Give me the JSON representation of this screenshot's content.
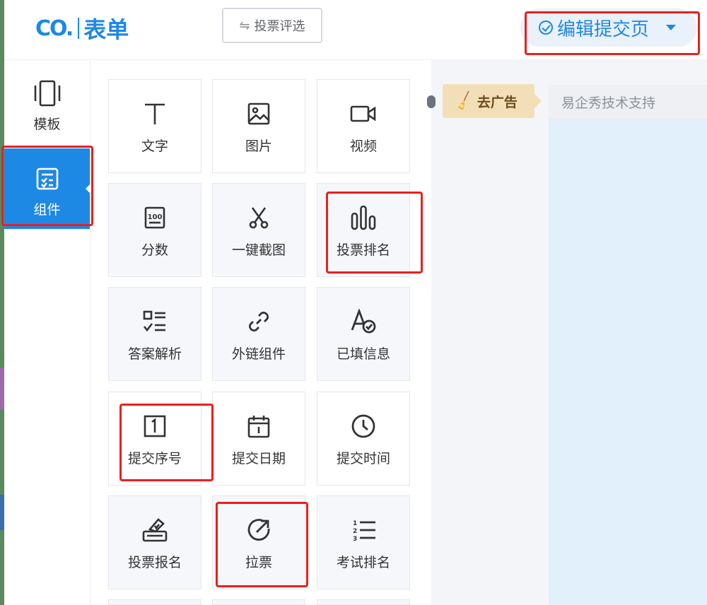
{
  "header": {
    "logo_mark": "CO.",
    "logo_text": "表单",
    "filter_button": "投票评选",
    "edit_menu": "编辑提交页"
  },
  "sidebar": {
    "items": [
      {
        "label": "模板",
        "icon": "template-icon",
        "active": false
      },
      {
        "label": "组件",
        "icon": "components-icon",
        "active": true
      }
    ]
  },
  "components": [
    {
      "label": "文字",
      "icon": "text-icon"
    },
    {
      "label": "图片",
      "icon": "image-icon"
    },
    {
      "label": "视频",
      "icon": "video-icon"
    },
    {
      "label": "分数",
      "icon": "score-icon"
    },
    {
      "label": "一键截图",
      "icon": "scissors-icon"
    },
    {
      "label": "投票排名",
      "icon": "ranking-bars-icon"
    },
    {
      "label": "答案解析",
      "icon": "answer-analysis-icon"
    },
    {
      "label": "外链组件",
      "icon": "link-icon"
    },
    {
      "label": "已填信息",
      "icon": "filled-info-icon"
    },
    {
      "label": "提交序号",
      "icon": "serial-number-icon"
    },
    {
      "label": "提交日期",
      "icon": "calendar-icon"
    },
    {
      "label": "提交时间",
      "icon": "clock-icon"
    },
    {
      "label": "投票报名",
      "icon": "ballot-icon"
    },
    {
      "label": "拉票",
      "icon": "share-arrow-icon"
    },
    {
      "label": "考试排名",
      "icon": "numbered-list-icon"
    }
  ],
  "preview": {
    "ad_button": "去广告",
    "support_text": "易企秀技术支持"
  },
  "colors": {
    "accent": "#1e88e5",
    "highlight": "#e8201f",
    "ad_background": "#f3dfb7",
    "canvas": "#e1f0fa"
  }
}
